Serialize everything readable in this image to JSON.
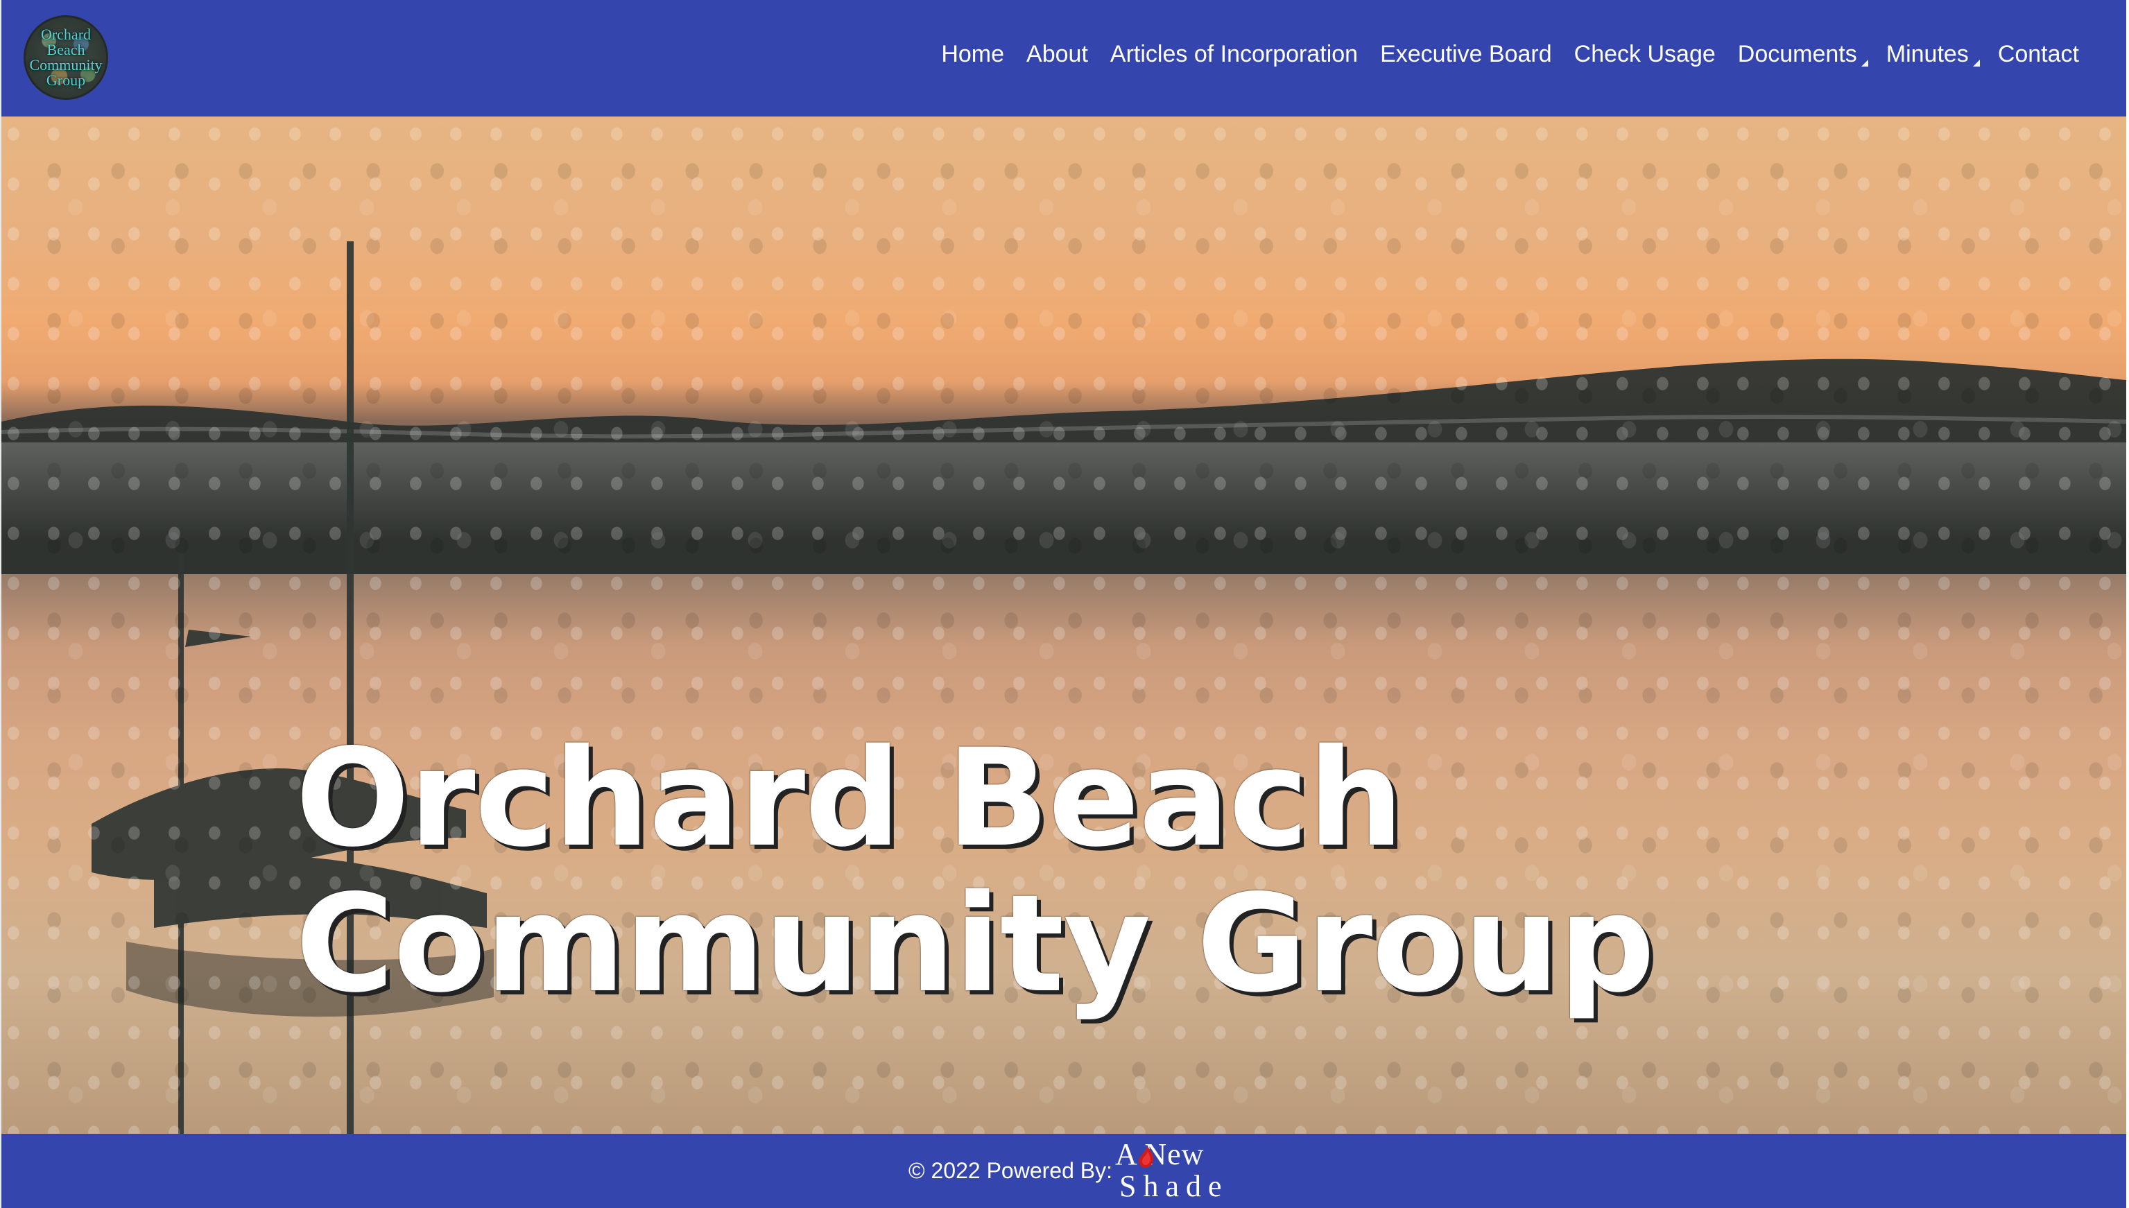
{
  "logo": {
    "alt_text": "Orchard Beach Community Group",
    "lines": "Orchard\nBeach\nCommunity\nGroup"
  },
  "nav": {
    "items": [
      {
        "label": "Home"
      },
      {
        "label": "About"
      },
      {
        "label": "Articles of Incorporation"
      },
      {
        "label": "Executive Board"
      },
      {
        "label": "Check Usage"
      },
      {
        "label": "Documents",
        "dropdown": true
      },
      {
        "label": "Minutes",
        "dropdown": true
      },
      {
        "label": "Contact"
      }
    ]
  },
  "hero": {
    "title": "Orchard Beach\nCommunity Group"
  },
  "footer": {
    "powered_text": "© 2022 Powered By:",
    "brand_top": "A New",
    "brand_bottom": "Shade"
  },
  "colors": {
    "header_footer_bg": "#3446ad",
    "text_on_blue": "#ffffff"
  },
  "icons": {
    "dropdown": "caret-icon",
    "brand_mark": "paint-drop-icon"
  }
}
